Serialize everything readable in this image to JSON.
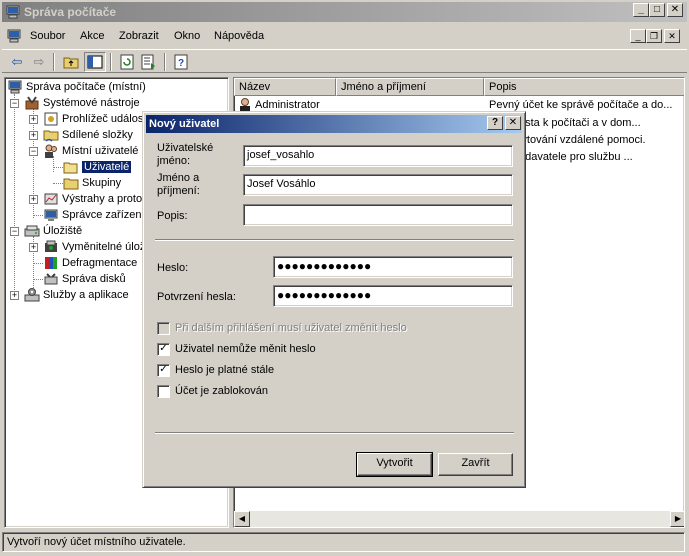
{
  "window": {
    "title": "Správa počítače"
  },
  "menu": [
    "Soubor",
    "Akce",
    "Zobrazit",
    "Okno",
    "Nápověda"
  ],
  "tree": {
    "root": "Správa počítače (místní)",
    "systemove": "Systémové nástroje",
    "prohlizec": "Prohlížeč událostí",
    "sdilene": "Sdílené složky",
    "mistni": "Místní uživatelé a",
    "uzivatele": "Uživatelé",
    "skupiny": "Skupiny",
    "vystrahy": "Výstrahy a proto",
    "spravce": "Správce zařízení",
    "uloziste": "Úložiště",
    "vymenitelne": "Vyměnitelné úlož",
    "defrag": "Defragmentace",
    "disky": "Správa disků",
    "sluzby": "Služby a aplikace"
  },
  "list": {
    "columns": [
      "Název",
      "Jméno a příjmení",
      "Popis"
    ],
    "rows": [
      {
        "name": "Administrator",
        "full": "",
        "desc": "Pevný účet ke správě počítače a do..."
      },
      {
        "name": "",
        "full": "",
        "desc": "účet hosta k počítači a v dom..."
      },
      {
        "name": "",
        "full": "",
        "desc": "o poskytování vzdálené pomoci."
      },
      {
        "name": "",
        "full": "",
        "desc": "účet dodavatele pro službu ..."
      }
    ]
  },
  "status": "Vytvoří nový účet místního uživatele.",
  "dialog": {
    "title": "Nový uživatel",
    "help": "?",
    "close": "✕",
    "username_label_1": "Uživatelské",
    "username_label_2": "jméno:",
    "username_value": "josef_vosahlo",
    "fullname_label_1": "Jméno a",
    "fullname_label_2": "příjmení:",
    "fullname_value": "Josef Vosáhlo",
    "desc_label": "Popis:",
    "desc_value": "",
    "password_label": "Heslo:",
    "password_value": "●●●●●●●●●●●●●",
    "confirm_label": "Potvrzení hesla:",
    "confirm_value": "●●●●●●●●●●●●●",
    "cb1": {
      "label": "Při dalším přihlášení musí uživatel změnit heslo",
      "checked": false,
      "disabled": true
    },
    "cb2": {
      "label": "Uživatel nemůže měnit heslo",
      "checked": true,
      "disabled": false
    },
    "cb3": {
      "label": "Heslo je platné stále",
      "checked": true,
      "disabled": false
    },
    "cb4": {
      "label": "Účet je zablokován",
      "checked": false,
      "disabled": false
    },
    "create_button": "Vytvořit",
    "close_button": "Zavřít"
  }
}
